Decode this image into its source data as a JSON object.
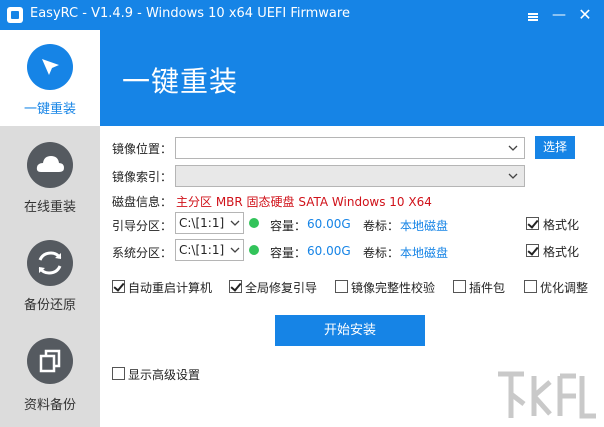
{
  "window": {
    "title": "EasyRC - V1.4.9 - Windows 10 x64 UEFI Firmware",
    "icons": [
      "menu-icon",
      "minimize-icon",
      "close-icon"
    ]
  },
  "banner": {
    "title": "一键重装"
  },
  "sidebar": {
    "items": [
      {
        "label": "一键重装",
        "icon": "cursor-arrow-icon",
        "active": true
      },
      {
        "label": "在线重装",
        "icon": "cloud-icon",
        "active": false
      },
      {
        "label": "备份还原",
        "icon": "refresh-arrows-icon",
        "active": false
      },
      {
        "label": "资料备份",
        "icon": "copy-files-icon",
        "active": false
      }
    ]
  },
  "form": {
    "image_location_label": "镜像位置：",
    "image_location_value": "",
    "choose_button": "选择",
    "image_index_label": "镜像索引：",
    "disk_info_label": "磁盘信息：",
    "disk_info_value": "主分区 MBR 固态硬盘 SATA Windows 10 X64",
    "boot_partition": {
      "label": "引导分区：",
      "value": "C:\\[1:1]",
      "capacity_label": "容量：",
      "capacity_value": "60.00G",
      "volume_label": "卷标：",
      "volume_value": "本地磁盘",
      "format_label": "格式化",
      "format_checked": true
    },
    "system_partition": {
      "label": "系统分区：",
      "value": "C:\\[1:1]",
      "capacity_label": "容量：",
      "capacity_value": "60.00G",
      "volume_label": "卷标：",
      "volume_value": "本地磁盘",
      "format_label": "格式化",
      "format_checked": true
    },
    "options": [
      {
        "label": "自动重启计算机",
        "checked": true
      },
      {
        "label": "全局修复引导",
        "checked": true
      },
      {
        "label": "镜像完整性校验",
        "checked": false
      },
      {
        "label": "插件包",
        "checked": false
      },
      {
        "label": "优化调整",
        "checked": false
      }
    ],
    "install_button": "开始安装",
    "advanced_label": "显示高级设置",
    "advanced_checked": false
  },
  "colors": {
    "accent": "#1684e6",
    "error_text": "#d0121a",
    "status_dot": "#32c35a",
    "sidebar_bg": "#dcdcdc"
  }
}
